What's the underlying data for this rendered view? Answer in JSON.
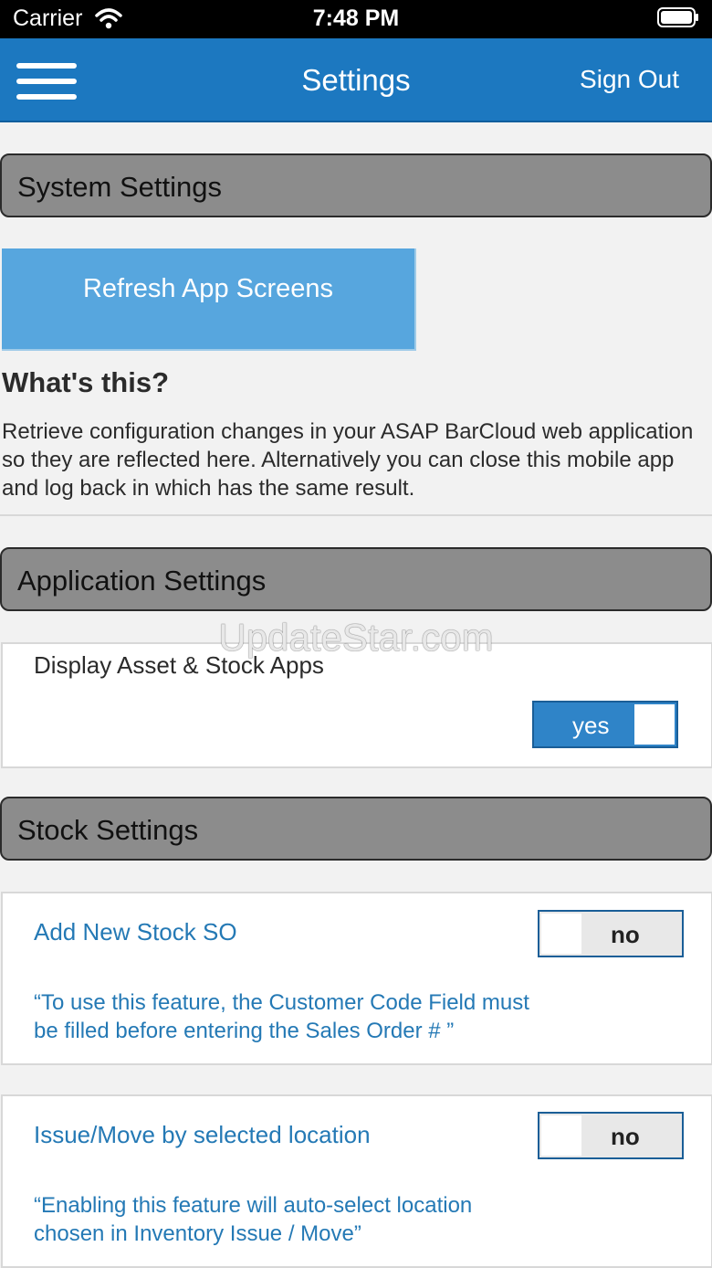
{
  "status_bar": {
    "carrier": "Carrier",
    "time": "7:48 PM",
    "icons": [
      "wifi-icon",
      "battery-icon"
    ]
  },
  "nav": {
    "menu_icon": "hamburger-menu-icon",
    "title": "Settings",
    "sign_out": "Sign Out"
  },
  "system_settings": {
    "header": "System Settings",
    "refresh_button": "Refresh App Screens",
    "help_title": "What's this?",
    "help_text": "Retrieve configuration changes in your ASAP BarCloud web application so they are reflected here. Alternatively you can close this mobile app and log back in which has the same result."
  },
  "application_settings": {
    "header": "Application Settings",
    "display_asset_stock": {
      "label": "Display Asset & Stock Apps",
      "toggle_text": "yes",
      "value": true
    }
  },
  "stock_settings": {
    "header": "Stock Settings",
    "add_new_stock_so": {
      "label": "Add New Stock SO",
      "toggle_text": "no",
      "value": false,
      "note": "“To use this feature, the Customer Code Field must be filled before entering the Sales Order # ”"
    },
    "issue_move_location": {
      "label": "Issue/Move by selected location",
      "toggle_text": "no",
      "value": false,
      "note": "“Enabling this feature will auto-select location chosen in Inventory Issue / Move”"
    }
  },
  "watermark": "UpdateStar.com",
  "colors": {
    "nav_bar": "#1c78c0",
    "section_header": "#8c8c8c",
    "refresh_button": "#57a6de",
    "toggle_on": "#2f84c8",
    "link_text": "#2479b5"
  }
}
